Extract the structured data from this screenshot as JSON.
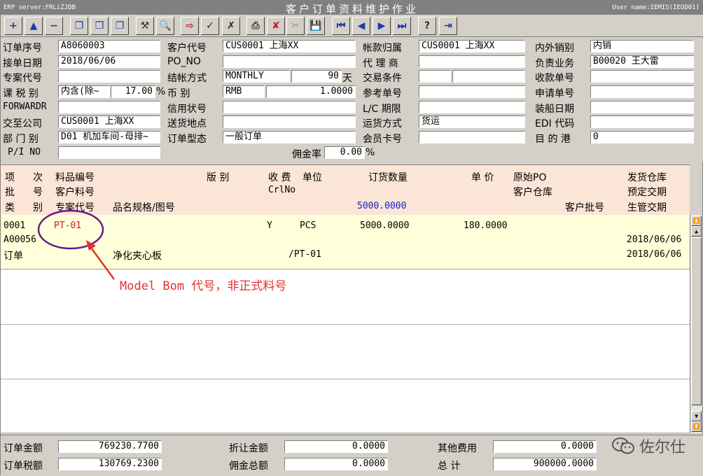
{
  "window": {
    "server": "ERP server:FRLiZJDB",
    "title": "客户订单资料维护作业",
    "user": "User name:IEMIS(IEOD01)"
  },
  "toolbar": [
    {
      "name": "add-record-button",
      "icon": "plus-icon",
      "glyph": "+",
      "color": "#1c3ca8"
    },
    {
      "name": "insert-record-button",
      "icon": "arrow-up-icon",
      "glyph": "▲",
      "color": "#1c3ca8"
    },
    {
      "name": "delete-record-button",
      "icon": "minus-icon",
      "glyph": "−",
      "color": "#1c3ca8"
    },
    {
      "name": "copy-record-button",
      "icon": "copy-icon",
      "glyph": "❐",
      "color": "#1c3ca8"
    },
    {
      "name": "copy-header-button",
      "icon": "copy-icon",
      "glyph": "❐",
      "color": "#1c3ca8"
    },
    {
      "name": "copy-detail-button",
      "icon": "copy-icon",
      "glyph": "❐",
      "color": "#1c3ca8"
    },
    {
      "name": "modify-button",
      "icon": "hammer-icon",
      "glyph": "⚒",
      "color": "#303030"
    },
    {
      "name": "query-button",
      "icon": "magnifier-icon",
      "glyph": "🔍",
      "color": "#303030"
    },
    {
      "name": "import-button",
      "icon": "import-icon",
      "glyph": "⇨",
      "color": "#c02020"
    },
    {
      "name": "confirm-button",
      "icon": "check-icon",
      "glyph": "✓",
      "color": "#202020"
    },
    {
      "name": "cancel-confirm-button",
      "icon": "x-box-icon",
      "glyph": "✗",
      "color": "#202020"
    },
    {
      "name": "print-button",
      "icon": "printer-icon",
      "glyph": "⎙",
      "color": "#303030"
    },
    {
      "name": "void-button",
      "icon": "void-icon",
      "glyph": "✘",
      "color": "#c02020"
    },
    {
      "name": "clear-button",
      "icon": "tools-icon",
      "glyph": "✂",
      "color": "#909090"
    },
    {
      "name": "save-button",
      "icon": "floppy-icon",
      "glyph": "💾",
      "color": "#303030"
    },
    {
      "name": "first-record-button",
      "icon": "first-icon",
      "glyph": "⏮",
      "color": "#1c3ca8"
    },
    {
      "name": "prev-record-button",
      "icon": "prev-icon",
      "glyph": "◀",
      "color": "#1c3ca8"
    },
    {
      "name": "next-record-button",
      "icon": "next-icon",
      "glyph": "▶",
      "color": "#1c3ca8"
    },
    {
      "name": "last-record-button",
      "icon": "last-icon",
      "glyph": "⏭",
      "color": "#1c3ca8"
    },
    {
      "name": "help-button",
      "icon": "help-icon",
      "glyph": "?",
      "color": "#303030"
    },
    {
      "name": "exit-button",
      "icon": "exit-door-icon",
      "glyph": "⇥",
      "color": "#1c3ca8"
    }
  ],
  "form": {
    "order_no_label": "订单序号",
    "order_no": "A8060003",
    "customer_code_label": "客户代号",
    "customer_code": "CUS0001 上海XX",
    "account_label": "帐款归属",
    "account": "CUS0001 上海XX",
    "domestic_label": "内外销别",
    "domestic": "内销",
    "order_date_label": "接单日期",
    "order_date": "2018/06/06",
    "po_no_label": "PO_NO",
    "po_no": "",
    "agent_label": "代 理 商",
    "agent": "",
    "salesperson_label": "负责业务",
    "salesperson": "B00020 王大雷",
    "project_label": "专案代号",
    "project": "",
    "settle_label": "结帐方式",
    "settle": "MONTHLY",
    "settle_days": "90",
    "settle_days_unit": "天",
    "trade_terms_label": "交易条件",
    "trade_terms": "",
    "trade_terms2": "",
    "receipt_no_label": "收款单号",
    "receipt_no": "",
    "tax_label": "课 税 别",
    "tax_type": "内含(除~",
    "tax_rate": "17.00",
    "tax_pct": "%",
    "currency_label": "币    别",
    "currency": "RMB",
    "exchange_rate": "1.0000",
    "ref_no_label": "参考单号",
    "ref_no": "",
    "apply_no_label": "申请单号",
    "apply_no": "",
    "forwarder_label": "FORWARDR",
    "forwarder": "",
    "lc_label": "信用状号",
    "lc": "",
    "lc_date_label": "L/C 期限",
    "lc_date": "",
    "ship_date_label": "装船日期",
    "ship_date": "",
    "deliver_to_label": "交至公司",
    "deliver_to": "CUS0001 上海XX",
    "ship_place_label": "送货地点",
    "ship_place": "",
    "ship_method_label": "运货方式",
    "ship_method": "货运",
    "edi_label": "EDI 代码",
    "edi": "",
    "dept_label": "部 门 别",
    "dept": "D01 机加车间-母排~",
    "order_type_label": "订单型态",
    "order_type": "一般订单",
    "member_label": "会员卡号",
    "member": "",
    "dest_port_label": "目 的 港",
    "dest_port": "0",
    "pi_no_label": "P/I NO",
    "pi_no": "",
    "commission_label": "佣金率",
    "commission": "0.00",
    "commission_pct": "%"
  },
  "grid": {
    "headers": {
      "h_item": "项",
      "h_seq": "次",
      "h_part": "料品编号",
      "h_ver": "版  别",
      "h_recv": "收 费",
      "h_unit": "单位",
      "h_qty": "订货数量",
      "h_price": "单  价",
      "h_po": "原始PO",
      "h_wh": "发货仓库",
      "h_batch": "批",
      "h_no": "号",
      "h_cust_part": "客户料号",
      "h_crl": "CrlNo",
      "h_cust_wh": "客户仓库",
      "h_plan_date": "预定交期",
      "h_type": "类",
      "h_kind": "别",
      "h_proj": "专案代号",
      "h_spec": "品名规格/图号",
      "h_cust_batch": "客户批号",
      "h_prod_date": "生管交期",
      "qty_total": "5000.0000"
    },
    "row": {
      "item": "0001",
      "part": "PT-01",
      "flag": "Y",
      "unit": "PCS",
      "qty": "5000.0000",
      "price": "180.0000",
      "batch": "A00056",
      "plan_date": "2018/06/06",
      "type": "订单",
      "spec": "净化夹心板",
      "drawing": "/PT-01",
      "prod_date": "2018/06/06"
    }
  },
  "footer": {
    "order_amt_label": "订单金额",
    "order_amt": "769230.7700",
    "discount_label": "折让金额",
    "discount": "0.0000",
    "other_fee_label": "其他费用",
    "other_fee": "0.0000",
    "order_tax_label": "订单税额",
    "order_tax": "130769.2300",
    "commission_total_label": "佣金总额",
    "commission_total": "0.0000",
    "total_label": "总    计",
    "total": "900000.0000"
  },
  "annotation": {
    "text": "Model Bom 代号，非正式料号",
    "color": "#e03030"
  },
  "watermark": {
    "text": "佐尔仕"
  }
}
